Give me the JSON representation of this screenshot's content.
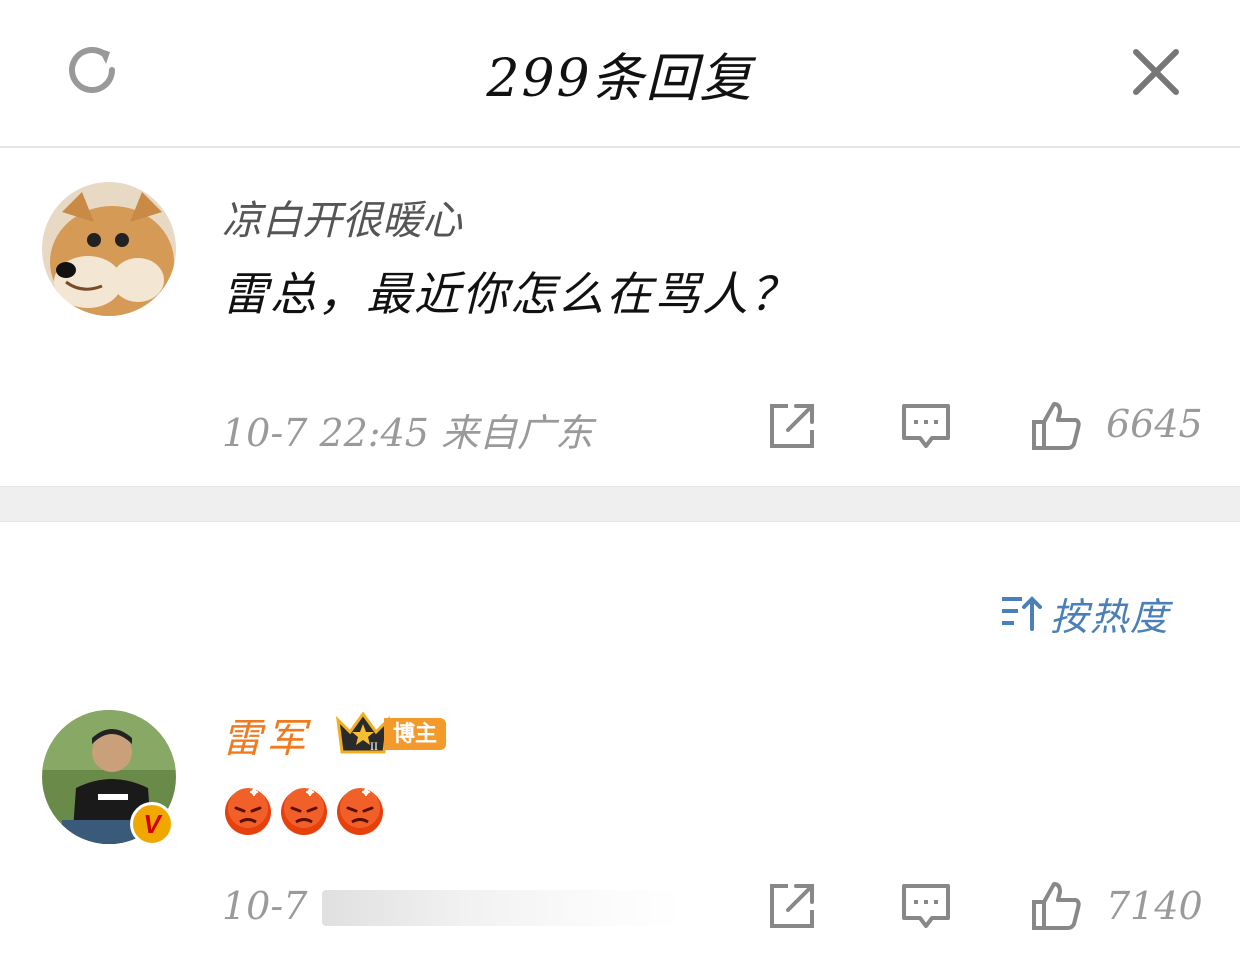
{
  "header": {
    "title": "299条回复",
    "refresh_icon": "refresh-icon",
    "close_icon": "close-icon"
  },
  "comments": [
    {
      "username": "凉白开很暖心",
      "content": "雷总，最近你怎么在骂人？",
      "time": "10-7 22:45 来自广东",
      "likes": "6645",
      "avatar": "shiba-dog-avatar"
    },
    {
      "username": "雷军",
      "badge_label": "博主",
      "badge_level": "II",
      "content_emojis": [
        "angry-face-emoji",
        "angry-face-emoji",
        "angry-face-emoji"
      ],
      "time": "10-7",
      "likes": "7140",
      "avatar": "man-in-black-tshirt-avatar",
      "verified": "V"
    }
  ],
  "sort": {
    "label": "按热度",
    "icon": "sort-icon"
  },
  "colors": {
    "username_highlight": "#f07a1e",
    "sort_blue": "#4a7fb8",
    "meta_gray": "#9a9a9a",
    "divider": "#efefef",
    "badge_orange": "#f39a2a"
  }
}
